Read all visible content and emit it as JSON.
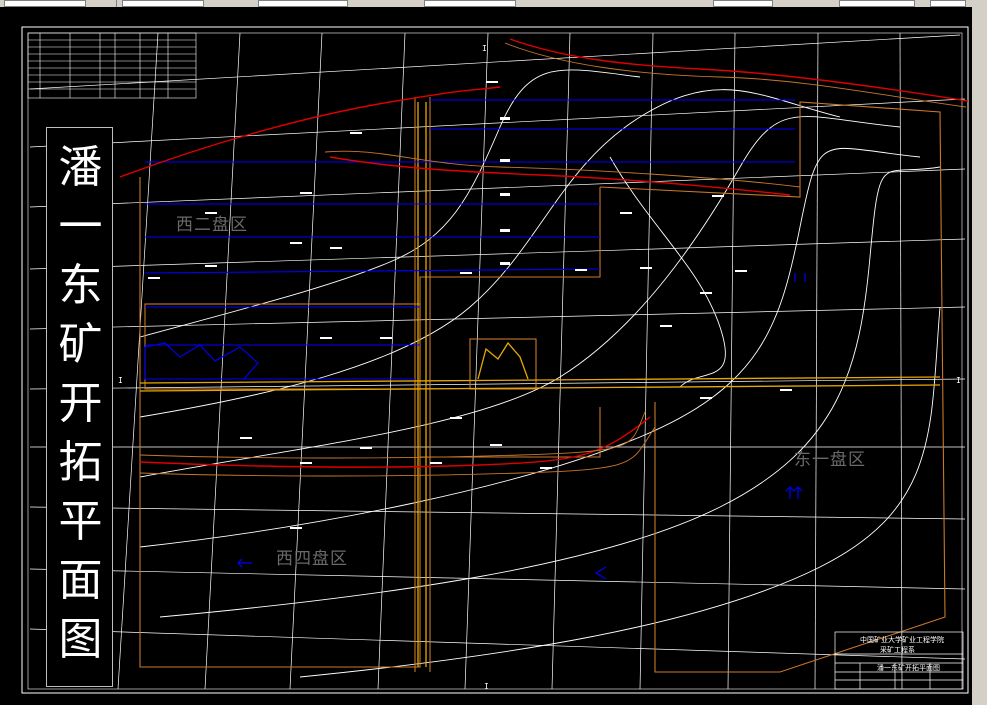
{
  "drawing": {
    "title_chars": [
      "潘",
      "一",
      "东",
      "矿",
      "开",
      "拓",
      "平",
      "面",
      "图"
    ],
    "zones": {
      "west_two": "西二盘区",
      "east_one": "东一盘区",
      "west_four": "西四盘区"
    },
    "title_block": {
      "line1": "中国矿业大学矿业工程学院",
      "line2": "采矿工程系",
      "drawing_name": "潘一东矿开拓平面图"
    },
    "section_marks": {
      "top": "I",
      "bottom": "I",
      "left": "I",
      "right": "I"
    },
    "colors": {
      "background": "#000000",
      "frame": "#ffffff",
      "contour": "#ffffff",
      "roadway_blue": "#0000ff",
      "fault_red": "#e00000",
      "boundary_orange": "#c8782a",
      "shaft_yellow": "#e6a800"
    }
  }
}
